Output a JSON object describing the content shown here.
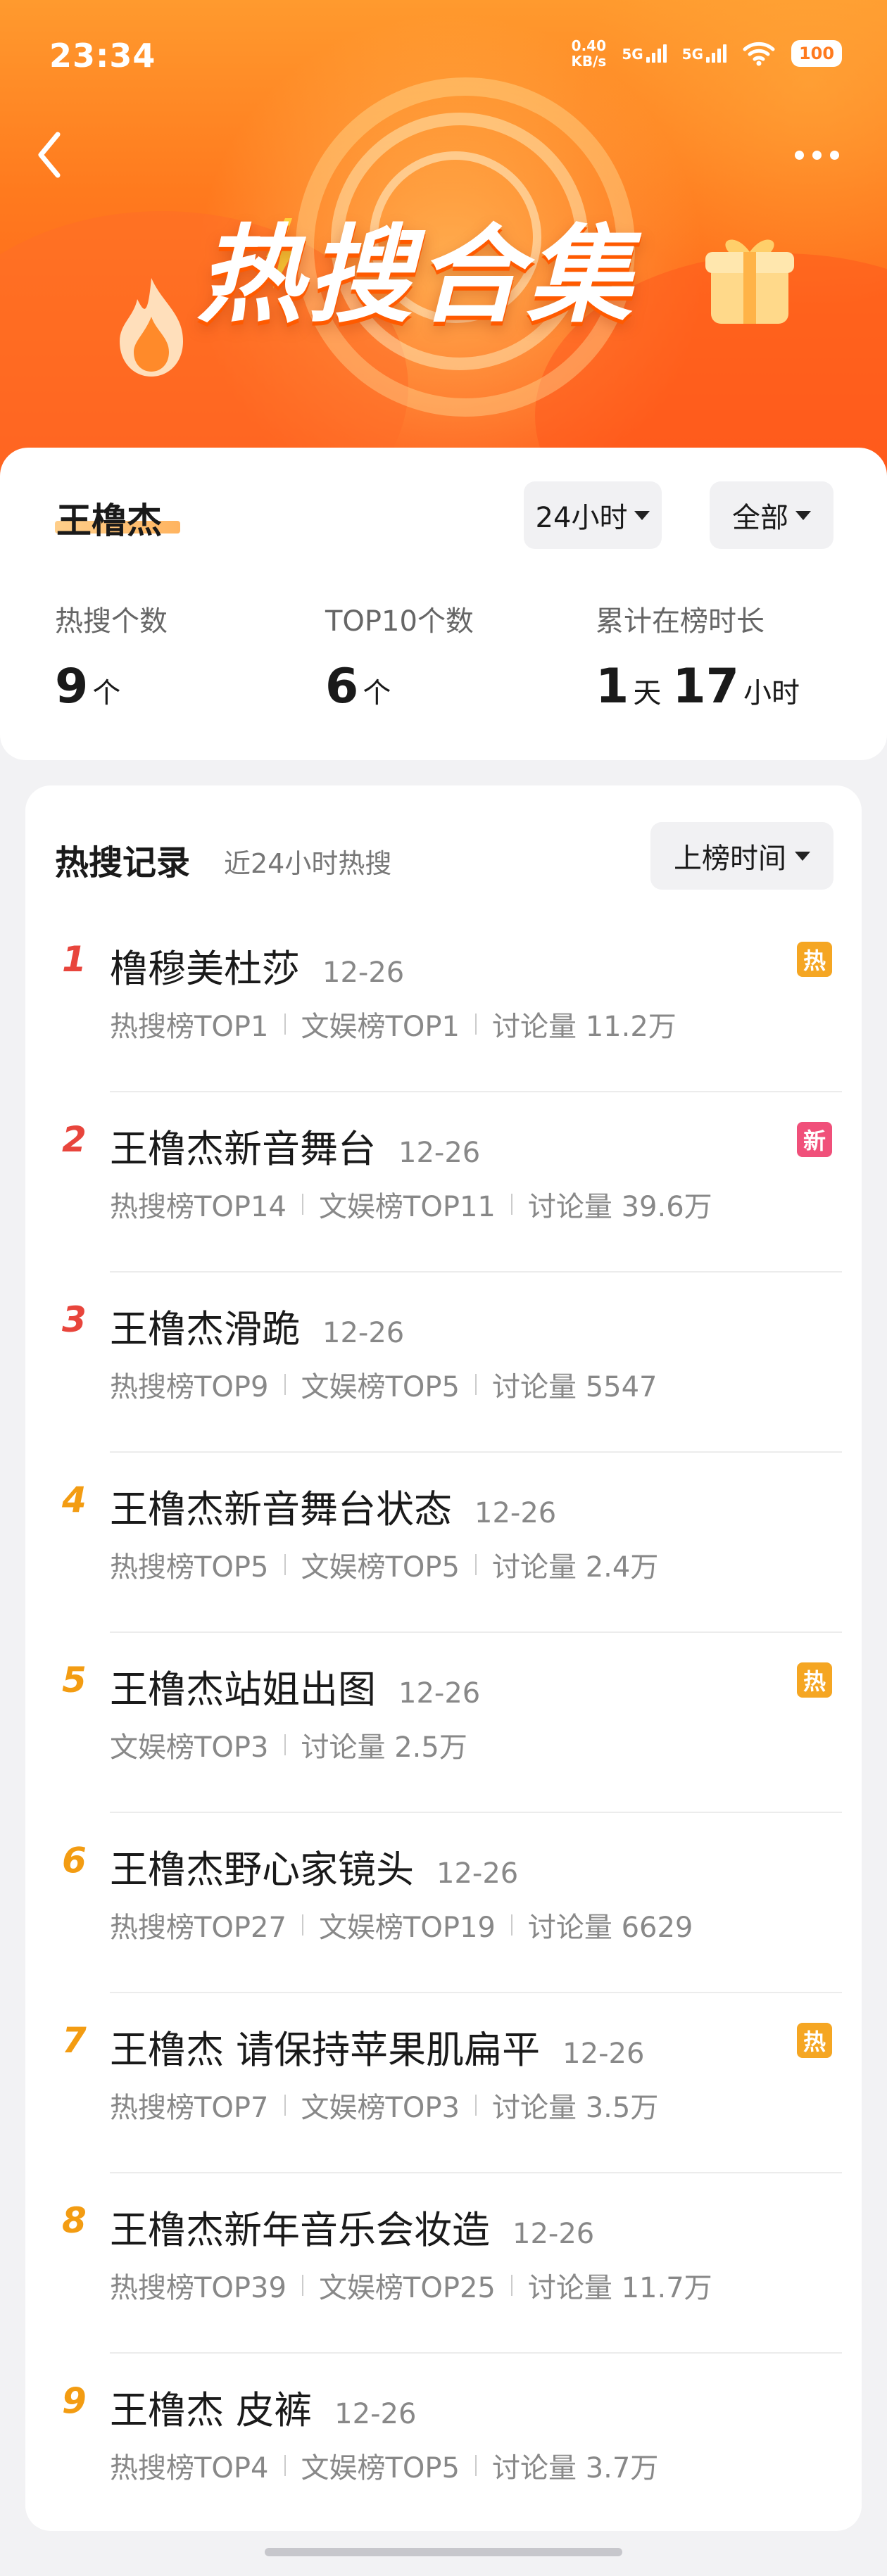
{
  "status_bar": {
    "time": "23:34",
    "net_speed_value": "0.40",
    "net_speed_unit": "KB/s",
    "signal1": "5G",
    "signal2": "5G",
    "battery": "100"
  },
  "banner": {
    "title": "热搜合集"
  },
  "summary": {
    "name": "王橹杰",
    "time_filter": "24小时",
    "scope_filter": "全部",
    "stats": [
      {
        "label": "热搜个数",
        "value": "9",
        "unit": "个"
      },
      {
        "label": "TOP10个数",
        "value": "6",
        "unit": "个"
      },
      {
        "label": "累计在榜时长",
        "value_days": "1",
        "unit_days": "天",
        "value_hours": "17",
        "unit_hours": "小时"
      }
    ]
  },
  "records": {
    "title": "热搜记录",
    "subtitle": "近24小时热搜",
    "sort_label": "上榜时间",
    "items": [
      {
        "rank": "1",
        "title": "橹穆美杜莎",
        "date": "12-26",
        "meta": [
          "热搜榜TOP1",
          "文娱榜TOP1",
          "讨论量 11.2万"
        ],
        "badge": "热",
        "badge_color": "#f5a623",
        "rank_color": "#e8453c"
      },
      {
        "rank": "2",
        "title": "王橹杰新音舞台",
        "date": "12-26",
        "meta": [
          "热搜榜TOP14",
          "文娱榜TOP11",
          "讨论量 39.6万"
        ],
        "badge": "新",
        "badge_color": "#f0507a",
        "rank_color": "#e8453c"
      },
      {
        "rank": "3",
        "title": "王橹杰滑跪",
        "date": "12-26",
        "meta": [
          "热搜榜TOP9",
          "文娱榜TOP5",
          "讨论量 5547"
        ],
        "badge": "",
        "badge_color": "",
        "rank_color": "#e8453c"
      },
      {
        "rank": "4",
        "title": "王橹杰新音舞台状态",
        "date": "12-26",
        "meta": [
          "热搜榜TOP5",
          "文娱榜TOP5",
          "讨论量 2.4万"
        ],
        "badge": "",
        "badge_color": "",
        "rank_color": "#f39c12"
      },
      {
        "rank": "5",
        "title": "王橹杰站姐出图",
        "date": "12-26",
        "meta": [
          "文娱榜TOP3",
          "讨论量 2.5万"
        ],
        "badge": "热",
        "badge_color": "#f5a623",
        "rank_color": "#f39c12"
      },
      {
        "rank": "6",
        "title": "王橹杰野心家镜头",
        "date": "12-26",
        "meta": [
          "热搜榜TOP27",
          "文娱榜TOP19",
          "讨论量 6629"
        ],
        "badge": "",
        "badge_color": "",
        "rank_color": "#f39c12"
      },
      {
        "rank": "7",
        "title": "王橹杰 请保持苹果肌扁平",
        "date": "12-26",
        "meta": [
          "热搜榜TOP7",
          "文娱榜TOP3",
          "讨论量 3.5万"
        ],
        "badge": "热",
        "badge_color": "#f5a623",
        "rank_color": "#f39c12"
      },
      {
        "rank": "8",
        "title": "王橹杰新年音乐会妆造",
        "date": "12-26",
        "meta": [
          "热搜榜TOP39",
          "文娱榜TOP25",
          "讨论量 11.7万"
        ],
        "badge": "",
        "badge_color": "",
        "rank_color": "#f39c12"
      },
      {
        "rank": "9",
        "title": "王橹杰 皮裤",
        "date": "12-26",
        "meta": [
          "热搜榜TOP4",
          "文娱榜TOP5",
          "讨论量 3.7万"
        ],
        "badge": "",
        "badge_color": "",
        "rank_color": "#f39c12"
      }
    ]
  }
}
